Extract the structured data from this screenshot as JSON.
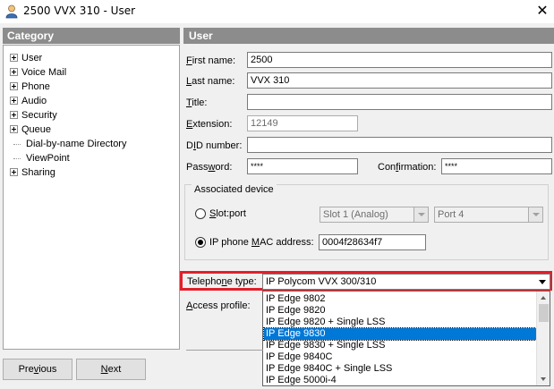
{
  "window": {
    "title": "2500 VVX 310 - User",
    "close_glyph": "✕",
    "icon": "user-person-icon"
  },
  "category": {
    "header": "Category",
    "items": [
      {
        "label": "User",
        "expandable": true
      },
      {
        "label": "Voice Mail",
        "expandable": true
      },
      {
        "label": "Phone",
        "expandable": true
      },
      {
        "label": "Audio",
        "expandable": true
      },
      {
        "label": "Security",
        "expandable": true
      },
      {
        "label": "Queue",
        "expandable": true
      },
      {
        "label": "Dial-by-name Directory",
        "expandable": false
      },
      {
        "label": "ViewPoint",
        "expandable": false
      },
      {
        "label": "Sharing",
        "expandable": true
      }
    ]
  },
  "user": {
    "header": "User",
    "first_name": {
      "label_u": "F",
      "label_rest": "irst name:",
      "value": "2500"
    },
    "last_name": {
      "label_u": "L",
      "label_rest": "ast name:",
      "value": "VVX 310"
    },
    "title": {
      "label_u": "T",
      "label_rest": "itle:",
      "value": ""
    },
    "extension": {
      "label_u": "E",
      "label_rest": "xtension:",
      "value": "12149"
    },
    "did": {
      "label_pre": "D",
      "label_u": "I",
      "label_rest": "D number:",
      "value": ""
    },
    "password": {
      "label_pre": "Pass",
      "label_u": "w",
      "label_rest": "ord:",
      "value": "****"
    },
    "confirmation": {
      "label_pre": "Con",
      "label_u": "f",
      "label_rest": "irmation:",
      "value": "****"
    }
  },
  "associated_device": {
    "title": "Associated device",
    "slot_port": {
      "label_u": "S",
      "label_rest": "lot:port",
      "checked": false,
      "slot_value": "Slot 1 (Analog)",
      "port_value": "Port 4"
    },
    "ip_phone": {
      "label_pre": "IP phone ",
      "label_u": "M",
      "label_rest": "AC address:",
      "checked": true,
      "value": "0004f28634f7"
    }
  },
  "telephone_type": {
    "label_pre": "Telepho",
    "label_u": "n",
    "label_rest": "e type:",
    "value": "IP Polycom VVX 300/310",
    "highlight_color": "#e0202a",
    "options": [
      "IP Edge 9802",
      "IP Edge 9820",
      "IP Edge 9820 + Single LSS",
      "IP Edge 9830",
      "IP Edge 9830 + Single LSS",
      "IP Edge 9840C",
      "IP Edge 9840C + Single LSS",
      "IP Edge 5000i-4"
    ],
    "selected_index": 3,
    "selection_color": "#0078d7"
  },
  "access_profile": {
    "label_pre": "",
    "label_u": "A",
    "label_rest": "ccess profile:"
  },
  "footer": {
    "previous": {
      "label_pre": "Pre",
      "label_u": "v",
      "label_rest": "ious"
    },
    "next": {
      "label_u": "N",
      "label_rest": "ext"
    }
  }
}
